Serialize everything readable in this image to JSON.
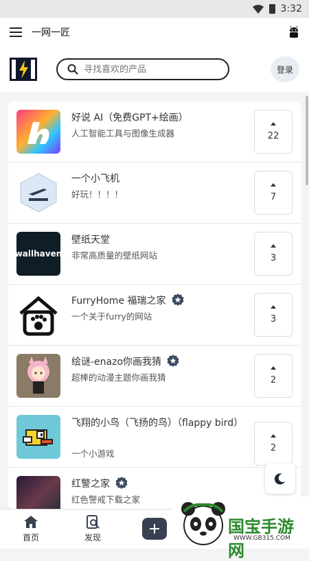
{
  "status": {
    "time": "3:32"
  },
  "appbar": {
    "title": "一网一匠"
  },
  "header": {
    "search_placeholder": "寻找喜欢的产品",
    "login_label": "登录"
  },
  "items": [
    {
      "name": "好说 AI（免费GPT+绘画）",
      "desc": "人工智能工具与图像生成器",
      "votes": "22",
      "badge": false
    },
    {
      "name": "一个小飞机",
      "desc": "好玩！！！！",
      "votes": "7",
      "badge": false
    },
    {
      "name": "壁纸天堂",
      "desc": "非常高质量的壁纸网站",
      "votes": "3",
      "badge": false,
      "thumb_text": "wallhaven"
    },
    {
      "name": "FurryHome 福瑞之家",
      "desc": "一个关于furry的网站",
      "votes": "3",
      "badge": true
    },
    {
      "name": "绘谜-enazo你画我猜",
      "desc": "超棒的动漫主题你画我猜",
      "votes": "2",
      "badge": true
    },
    {
      "name": "飞翔的小鸟（飞扬的鸟）（flappy bird）",
      "desc": "一个小游戏",
      "votes": "2",
      "badge": false
    },
    {
      "name": "红警之家",
      "desc": "红色警戒下载之家",
      "votes": "",
      "badge": true
    }
  ],
  "nav": {
    "home_label": "首页",
    "discover_label": "发现"
  },
  "watermark": {
    "text": "国宝手游网",
    "url": "WWW.GB315.COM"
  }
}
